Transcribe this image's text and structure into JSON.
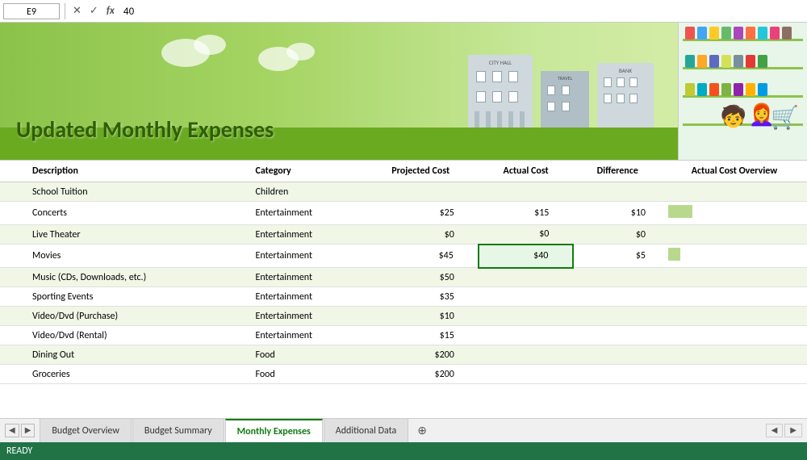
{
  "formula_bar": {
    "cell_ref": "E9",
    "value": "40",
    "cancel_label": "✕",
    "confirm_label": "✓",
    "fx_label": "fx"
  },
  "banner": {
    "title": "Updated Monthly Expenses"
  },
  "table": {
    "headers": {
      "description": "Description",
      "category": "Category",
      "projected_cost": "Projected Cost",
      "actual_cost": "Actual Cost",
      "difference": "Difference",
      "overview": "Actual Cost Overview"
    },
    "rows": [
      {
        "description": "School Tuition",
        "category": "Children",
        "projected": "",
        "actual": "",
        "difference": "",
        "bar": 0
      },
      {
        "description": "Concerts",
        "category": "Entertainment",
        "projected": "$25",
        "actual": "$15",
        "difference": "$10",
        "bar": 30
      },
      {
        "description": "Live Theater",
        "category": "Entertainment",
        "projected": "$0",
        "actual": "$0",
        "difference": "$0",
        "bar": 0
      },
      {
        "description": "Movies",
        "category": "Entertainment",
        "projected": "$45",
        "actual": "$40",
        "difference": "$5",
        "bar": 15,
        "selected_actual": true
      },
      {
        "description": "Music (CDs, Downloads, etc.)",
        "category": "Entertainment",
        "projected": "$50",
        "actual": "",
        "difference": "",
        "bar": 0
      },
      {
        "description": "Sporting Events",
        "category": "Entertainment",
        "projected": "$35",
        "actual": "",
        "difference": "",
        "bar": 0
      },
      {
        "description": "Video/Dvd (Purchase)",
        "category": "Entertainment",
        "projected": "$10",
        "actual": "",
        "difference": "",
        "bar": 0
      },
      {
        "description": "Video/Dvd (Rental)",
        "category": "Entertainment",
        "projected": "$15",
        "actual": "",
        "difference": "",
        "bar": 0
      },
      {
        "description": "Dining Out",
        "category": "Food",
        "projected": "$200",
        "actual": "",
        "difference": "",
        "bar": 0
      },
      {
        "description": "Groceries",
        "category": "Food",
        "projected": "$200",
        "actual": "",
        "difference": "",
        "bar": 0
      }
    ]
  },
  "tabs": [
    {
      "label": "Budget Overview",
      "active": false
    },
    {
      "label": "Budget Summary",
      "active": false
    },
    {
      "label": "Monthly Expenses",
      "active": true
    },
    {
      "label": "Additional Data",
      "active": false
    }
  ],
  "status": {
    "text": "READY"
  }
}
